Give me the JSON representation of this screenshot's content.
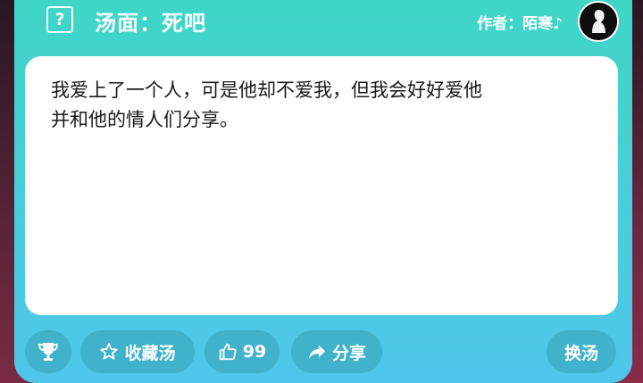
{
  "header": {
    "title": "汤面：死吧",
    "author_label": "作者：陌寒♪"
  },
  "content": {
    "text_line1": "我爱上了一个人，可是他却不爱我，但我会好好爱他",
    "text_line2": "并和他的情人们分享。"
  },
  "toolbar": {
    "collect_label": "收藏汤",
    "like_count": "99",
    "share_label": "分享",
    "switch_label": "换汤"
  },
  "icons": {
    "question": "question-icon",
    "trophy": "trophy-icon",
    "star": "star-icon",
    "thumb": "thumbs-up-icon",
    "share": "share-arrow-icon"
  },
  "colors": {
    "card_top": "#3fd6c6",
    "card_bottom": "#4fc6ea",
    "background": "#3a1626"
  }
}
